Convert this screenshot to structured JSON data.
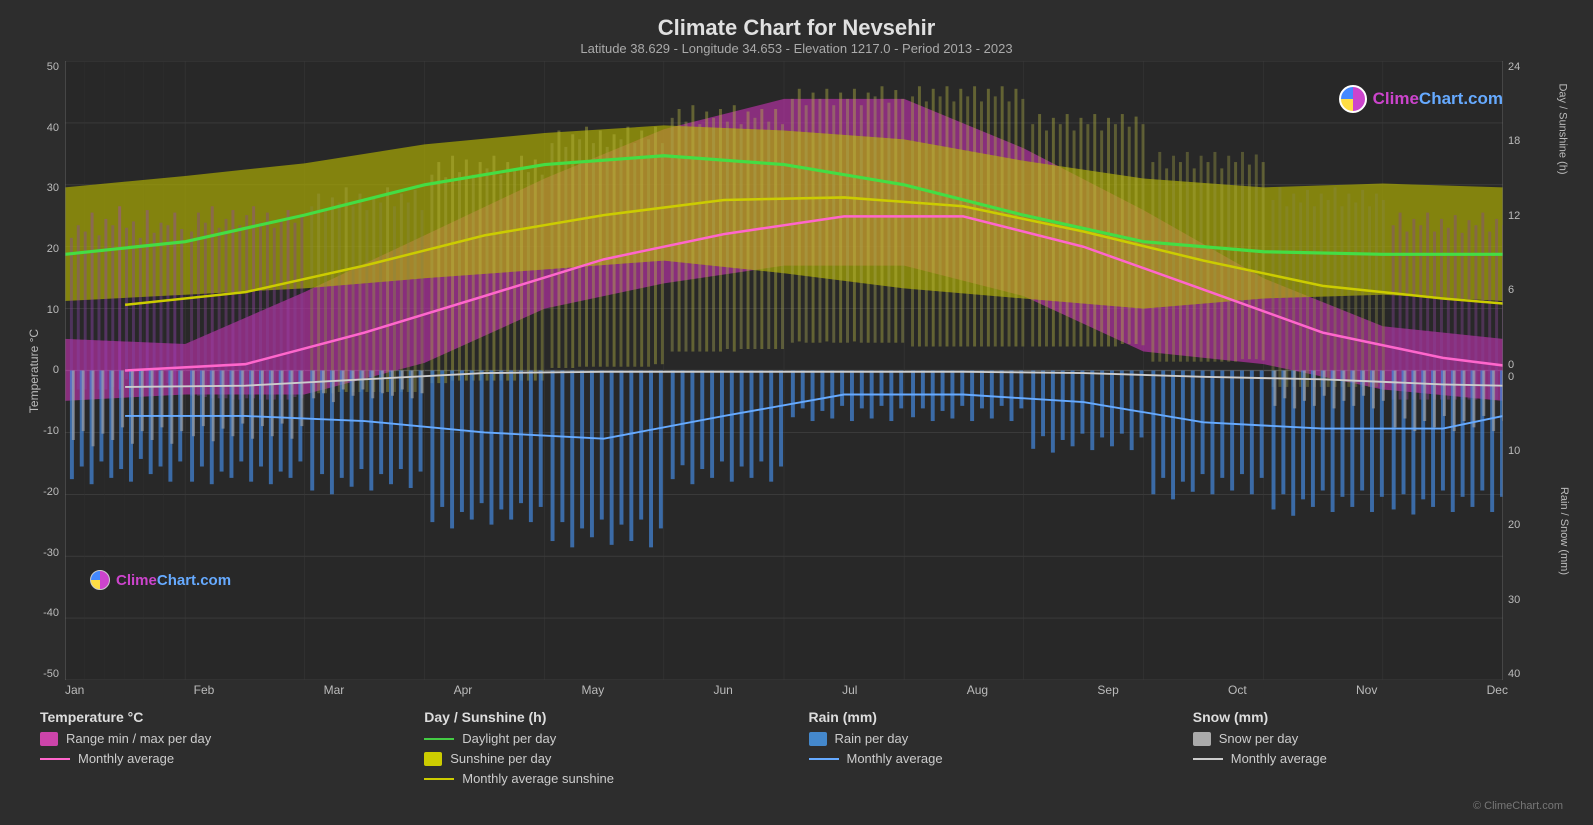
{
  "title": "Climate Chart for Nevsehir",
  "subtitle": "Latitude 38.629 - Longitude 34.653 - Elevation 1217.0 - Period 2013 - 2023",
  "yaxis_left": {
    "label": "Temperature °C",
    "ticks": [
      "50",
      "40",
      "30",
      "20",
      "10",
      "0",
      "-10",
      "-20",
      "-30",
      "-40",
      "-50"
    ]
  },
  "yaxis_right_top": {
    "label": "Day / Sunshine (h)",
    "ticks": [
      "24",
      "18",
      "12",
      "6",
      "0"
    ]
  },
  "yaxis_right_bottom": {
    "label": "Rain / Snow (mm)",
    "ticks": [
      "0",
      "10",
      "20",
      "30",
      "40"
    ]
  },
  "xaxis": {
    "months": [
      "Jan",
      "Feb",
      "Mar",
      "Apr",
      "May",
      "Jun",
      "Jul",
      "Aug",
      "Sep",
      "Oct",
      "Nov",
      "Dec"
    ]
  },
  "legend": {
    "temperature": {
      "title": "Temperature °C",
      "items": [
        {
          "label": "Range min / max per day",
          "type": "rect",
          "color": "#cc44aa"
        },
        {
          "label": "Monthly average",
          "type": "line",
          "color": "#ff66cc"
        }
      ]
    },
    "sunshine": {
      "title": "Day / Sunshine (h)",
      "items": [
        {
          "label": "Daylight per day",
          "type": "line",
          "color": "#44cc44"
        },
        {
          "label": "Sunshine per day",
          "type": "rect",
          "color": "#cccc00"
        },
        {
          "label": "Monthly average sunshine",
          "type": "line",
          "color": "#cccc00"
        }
      ]
    },
    "rain": {
      "title": "Rain (mm)",
      "items": [
        {
          "label": "Rain per day",
          "type": "rect",
          "color": "#4488cc"
        },
        {
          "label": "Monthly average",
          "type": "line",
          "color": "#66aaff"
        }
      ]
    },
    "snow": {
      "title": "Snow (mm)",
      "items": [
        {
          "label": "Snow per day",
          "type": "rect",
          "color": "#aaaaaa"
        },
        {
          "label": "Monthly average",
          "type": "line",
          "color": "#cccccc"
        }
      ]
    }
  },
  "watermark": "© ClimeChart.com",
  "logo": "ClimeChart.com"
}
